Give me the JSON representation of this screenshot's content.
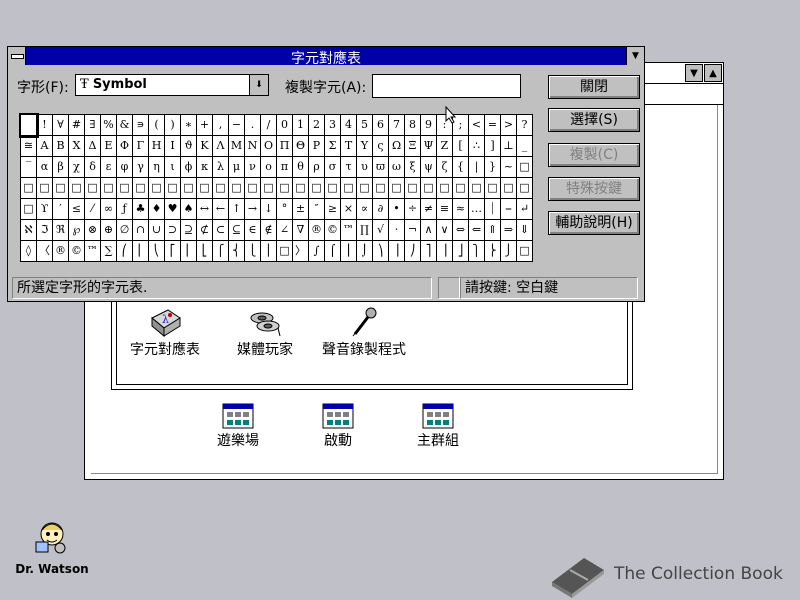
{
  "charmap": {
    "title": "字元對應表",
    "font_label": "字形(F):",
    "font_value": "Symbol",
    "copy_label": "複製字元(A):",
    "copy_value": "",
    "buttons": {
      "close": "關閉",
      "select": "選擇(S)",
      "copy": "複製(C)",
      "keystroke": "特殊按鍵",
      "help": "輔助說明(H)"
    },
    "status_left": "所選定字形的字元表.",
    "status_right": "請按鍵: 空白鍵",
    "grid": [
      [
        " ",
        "!",
        "∀",
        "#",
        "∃",
        "%",
        "&",
        "∍",
        "(",
        ")",
        "∗",
        "+",
        ",",
        "−",
        ".",
        "/",
        "0",
        "1",
        "2",
        "3",
        "4",
        "5",
        "6",
        "7",
        "8",
        "9",
        ":",
        ";",
        "<",
        "=",
        ">",
        "?"
      ],
      [
        "≅",
        "Α",
        "Β",
        "Χ",
        "Δ",
        "Ε",
        "Φ",
        "Γ",
        "Η",
        "Ι",
        "ϑ",
        "Κ",
        "Λ",
        "Μ",
        "Ν",
        "Ο",
        "Π",
        "Θ",
        "Ρ",
        "Σ",
        "Τ",
        "Υ",
        "ς",
        "Ω",
        "Ξ",
        "Ψ",
        "Ζ",
        "[",
        "∴",
        "]",
        "⊥",
        "_"
      ],
      [
        "‾",
        "α",
        "β",
        "χ",
        "δ",
        "ε",
        "φ",
        "γ",
        "η",
        "ι",
        "ϕ",
        "κ",
        "λ",
        "μ",
        "ν",
        "ο",
        "π",
        "θ",
        "ρ",
        "σ",
        "τ",
        "υ",
        "ϖ",
        "ω",
        "ξ",
        "ψ",
        "ζ",
        "{",
        "|",
        "}",
        "~",
        "□"
      ],
      [
        "□",
        "□",
        "□",
        "□",
        "□",
        "□",
        "□",
        "□",
        "□",
        "□",
        "□",
        "□",
        "□",
        "□",
        "□",
        "□",
        "□",
        "□",
        "□",
        "□",
        "□",
        "□",
        "□",
        "□",
        "□",
        "□",
        "□",
        "□",
        "□",
        "□",
        "□",
        "□"
      ],
      [
        "□",
        "ϒ",
        "′",
        "≤",
        "⁄",
        "∞",
        "ƒ",
        "♣",
        "♦",
        "♥",
        "♠",
        "↔",
        "←",
        "↑",
        "→",
        "↓",
        "°",
        "±",
        "″",
        "≥",
        "×",
        "∝",
        "∂",
        "•",
        "÷",
        "≠",
        "≡",
        "≈",
        "…",
        "⏐",
        "⎯",
        "↵"
      ],
      [
        "ℵ",
        "ℑ",
        "ℜ",
        "℘",
        "⊗",
        "⊕",
        "∅",
        "∩",
        "∪",
        "⊃",
        "⊇",
        "⊄",
        "⊂",
        "⊆",
        "∈",
        "∉",
        "∠",
        "∇",
        "®",
        "©",
        "™",
        "∏",
        "√",
        "⋅",
        "¬",
        "∧",
        "∨",
        "⇔",
        "⇐",
        "⇑",
        "⇒",
        "⇓"
      ],
      [
        "◊",
        "〈",
        "®",
        "©",
        "™",
        "∑",
        "⎛",
        "⎜",
        "⎝",
        "⎡",
        "⎢",
        "⎣",
        "⎧",
        "⎨",
        "⎩",
        "⎪",
        "□",
        "〉",
        "∫",
        "⌠",
        "⎮",
        "⌡",
        "⎞",
        "⎟",
        "⎠",
        "⎤",
        "⎥",
        "⎦",
        "⎫",
        "⎬",
        "⎭",
        "□"
      ]
    ]
  },
  "program_manager": {
    "group_items": [
      {
        "label": "字元對應表",
        "icon": "charmap-icon"
      },
      {
        "label": "媒體玩家",
        "icon": "media-player-icon"
      },
      {
        "label": "聲音錄製程式",
        "icon": "sound-recorder-icon"
      }
    ],
    "groups": [
      {
        "label": "遊樂場",
        "icon": "program-group-icon"
      },
      {
        "label": "啟動",
        "icon": "program-group-icon"
      },
      {
        "label": "主群組",
        "icon": "program-group-icon"
      }
    ]
  },
  "desktop": {
    "watson_label": "Dr. Watson",
    "watermark": "The Collection Book"
  },
  "colors": {
    "titlebar_active": "#0000a8",
    "desktop": "#c0c0c8",
    "face": "#c0c0c0"
  }
}
